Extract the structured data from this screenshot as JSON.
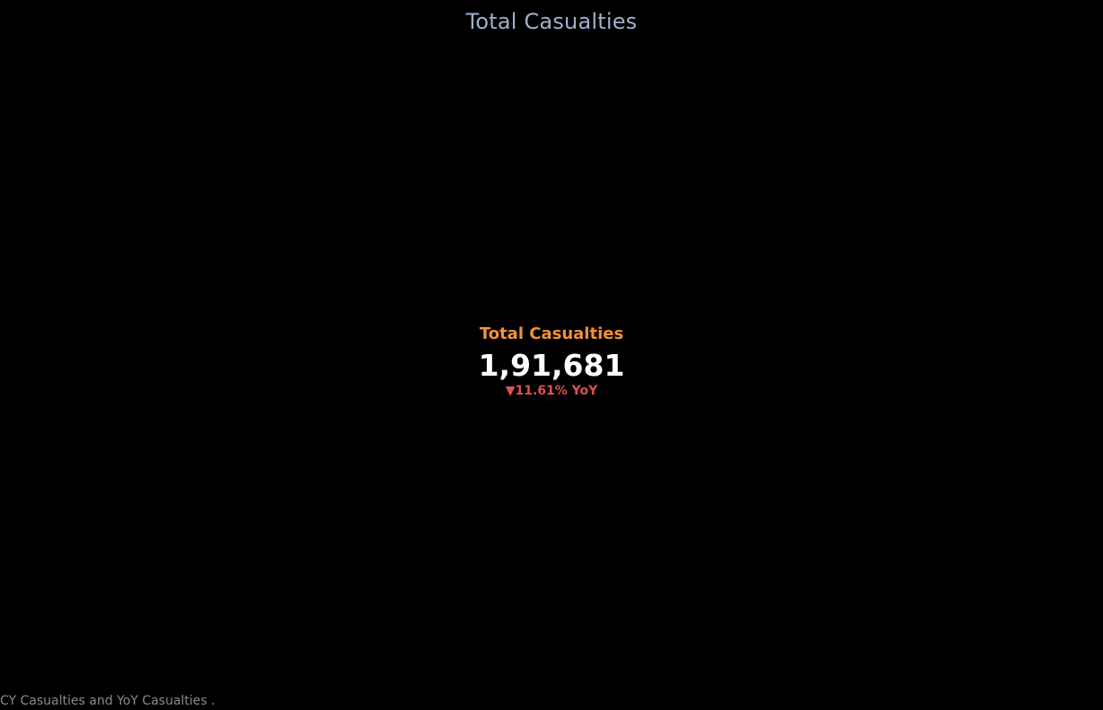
{
  "header": {
    "title": "Total Casualties"
  },
  "kpi": {
    "label": "Total Casualties",
    "value": "1,91,681",
    "change": {
      "arrow": "▼",
      "text": "11.61% YoY",
      "direction": "down",
      "color": "#d9534f"
    }
  },
  "footer": {
    "caption": "CY Casualties and YoY Casualties ."
  },
  "colors": {
    "background": "#000000",
    "title": "#9fb0cc",
    "label": "#f0913a",
    "value": "#ffffff"
  }
}
